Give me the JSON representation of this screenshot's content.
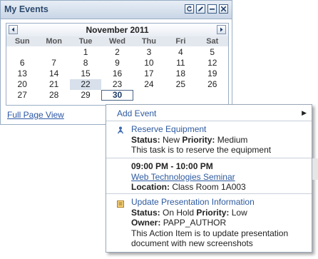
{
  "portlet": {
    "title": "My Events",
    "icons": [
      "refresh-icon",
      "edit-icon",
      "minimize-icon",
      "close-icon"
    ]
  },
  "calendar": {
    "month_label": "November 2011",
    "prev_icon": "triangle-left-icon",
    "next_icon": "triangle-right-icon",
    "days_of_week": [
      "Sun",
      "Mon",
      "Tue",
      "Wed",
      "Thu",
      "Fri",
      "Sat"
    ],
    "weeks": [
      [
        "",
        "",
        "1",
        "2",
        "3",
        "4",
        "5"
      ],
      [
        "6",
        "7",
        "8",
        "9",
        "10",
        "11",
        "12"
      ],
      [
        "13",
        "14",
        "15",
        "16",
        "17",
        "18",
        "19"
      ],
      [
        "20",
        "21",
        "22",
        "23",
        "24",
        "25",
        "26"
      ],
      [
        "27",
        "28",
        "29",
        "30",
        "",
        "",
        ""
      ]
    ],
    "highlighted_day": "22",
    "selected_day": "30"
  },
  "full_page_link": "Full Page View",
  "popup": {
    "add_event": "Add Event",
    "submenu_icon": "triangle-right-icon",
    "items": [
      {
        "icon": "task-icon",
        "title": "Reserve Equipment",
        "status_label": "Status:",
        "status_value": "New",
        "priority_label": "Priority:",
        "priority_value": "Medium",
        "description": "This task is to reserve the equipment"
      },
      {
        "time": "09:00 PM - 10:00 PM",
        "title": "Web Technologies Seminar",
        "location_label": "Location:",
        "location_value": "Class Room 1A003"
      },
      {
        "icon": "action-item-icon",
        "title": "Update Presentation Information",
        "status_label": "Status:",
        "status_value": "On Hold",
        "priority_label": "Priority:",
        "priority_value": "Low",
        "owner_label": "Owner:",
        "owner_value": "PAPP_AUTHOR",
        "description_line1": "This Action Item is to update presentation",
        "description_line2": "document with new screenshots"
      }
    ]
  },
  "colors": {
    "link": "#2d5aa0",
    "header_title": "#2d4a6e",
    "border": "#98adc5",
    "today_bg": "#d7e0eb"
  }
}
